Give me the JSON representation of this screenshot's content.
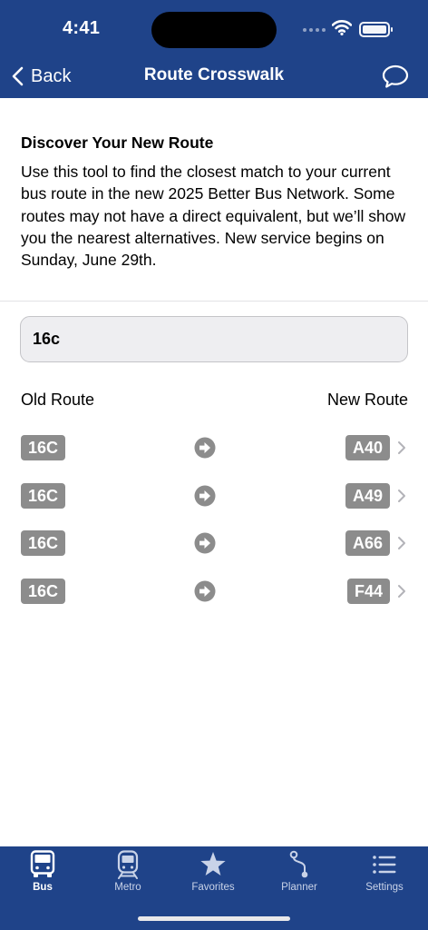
{
  "status": {
    "time": "4:41"
  },
  "nav": {
    "back_label": "Back",
    "title": "Route Crosswalk"
  },
  "intro": {
    "title": "Discover Your New Route",
    "body": "Use this tool to find the closest match to your current bus route in the new 2025 Better Bus Network. Some routes may not have a direct equivalent, but we’ll show you the nearest alternatives. New service begins on Sunday, June 29th."
  },
  "search": {
    "value": "16c"
  },
  "columns": {
    "old": "Old Route",
    "new": "New Route"
  },
  "routes": [
    {
      "old": "16C",
      "new": "A40"
    },
    {
      "old": "16C",
      "new": "A49"
    },
    {
      "old": "16C",
      "new": "A66"
    },
    {
      "old": "16C",
      "new": "F44"
    }
  ],
  "tabs": [
    {
      "label": "Bus",
      "icon": "bus-icon",
      "active": true
    },
    {
      "label": "Metro",
      "icon": "metro-icon",
      "active": false
    },
    {
      "label": "Favorites",
      "icon": "star-icon",
      "active": false
    },
    {
      "label": "Planner",
      "icon": "route-icon",
      "active": false
    },
    {
      "label": "Settings",
      "icon": "list-icon",
      "active": false
    }
  ],
  "colors": {
    "brand": "#1f4389",
    "badge": "#8c8c8c",
    "inactive_tab": "#c9d3e8"
  }
}
